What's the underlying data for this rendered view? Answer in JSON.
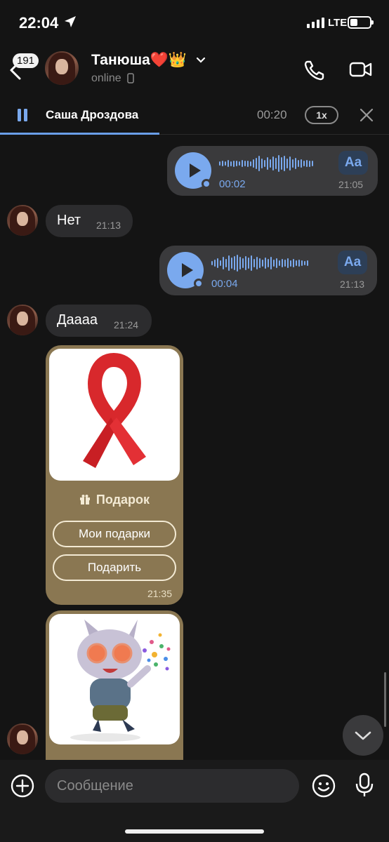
{
  "status_bar": {
    "time": "22:04",
    "network": "LTE"
  },
  "header": {
    "unread_count": "191",
    "contact_name": "Танюша❤️👑",
    "contact_status": "online"
  },
  "player": {
    "name": "Саша Дроздова",
    "time": "00:20",
    "speed": "1x",
    "progress": 0.41
  },
  "messages": [
    {
      "type": "voice",
      "direction": "out",
      "duration": "00:02",
      "time": "21:05",
      "transcribe_label": "Aa"
    },
    {
      "type": "text",
      "direction": "in",
      "text": "Нет",
      "time": "21:13"
    },
    {
      "type": "voice",
      "direction": "out",
      "duration": "00:04",
      "time": "21:13",
      "transcribe_label": "Aa"
    },
    {
      "type": "text",
      "direction": "in",
      "text": "Даааа",
      "time": "21:24"
    },
    {
      "type": "gift",
      "direction": "in",
      "label": "Подарок",
      "buttons": [
        "Мои подарки",
        "Подарить"
      ],
      "time": "21:35"
    },
    {
      "type": "gift",
      "direction": "in",
      "label": ""
    }
  ],
  "composer": {
    "placeholder": "Сообщение"
  },
  "colors": {
    "accent": "#7aa9ee",
    "gift_bubble": "#8a7752",
    "background": "#141414",
    "bubble": "#2c2c2e",
    "ribbon": "#d8282c"
  },
  "icons": [
    "location-arrow-icon",
    "back-chevron-icon",
    "phone-icon",
    "video-camera-icon",
    "pause-icon",
    "close-icon",
    "play-icon",
    "gift-icon",
    "chevron-down-icon",
    "plus-icon",
    "emoji-icon",
    "microphone-icon"
  ]
}
